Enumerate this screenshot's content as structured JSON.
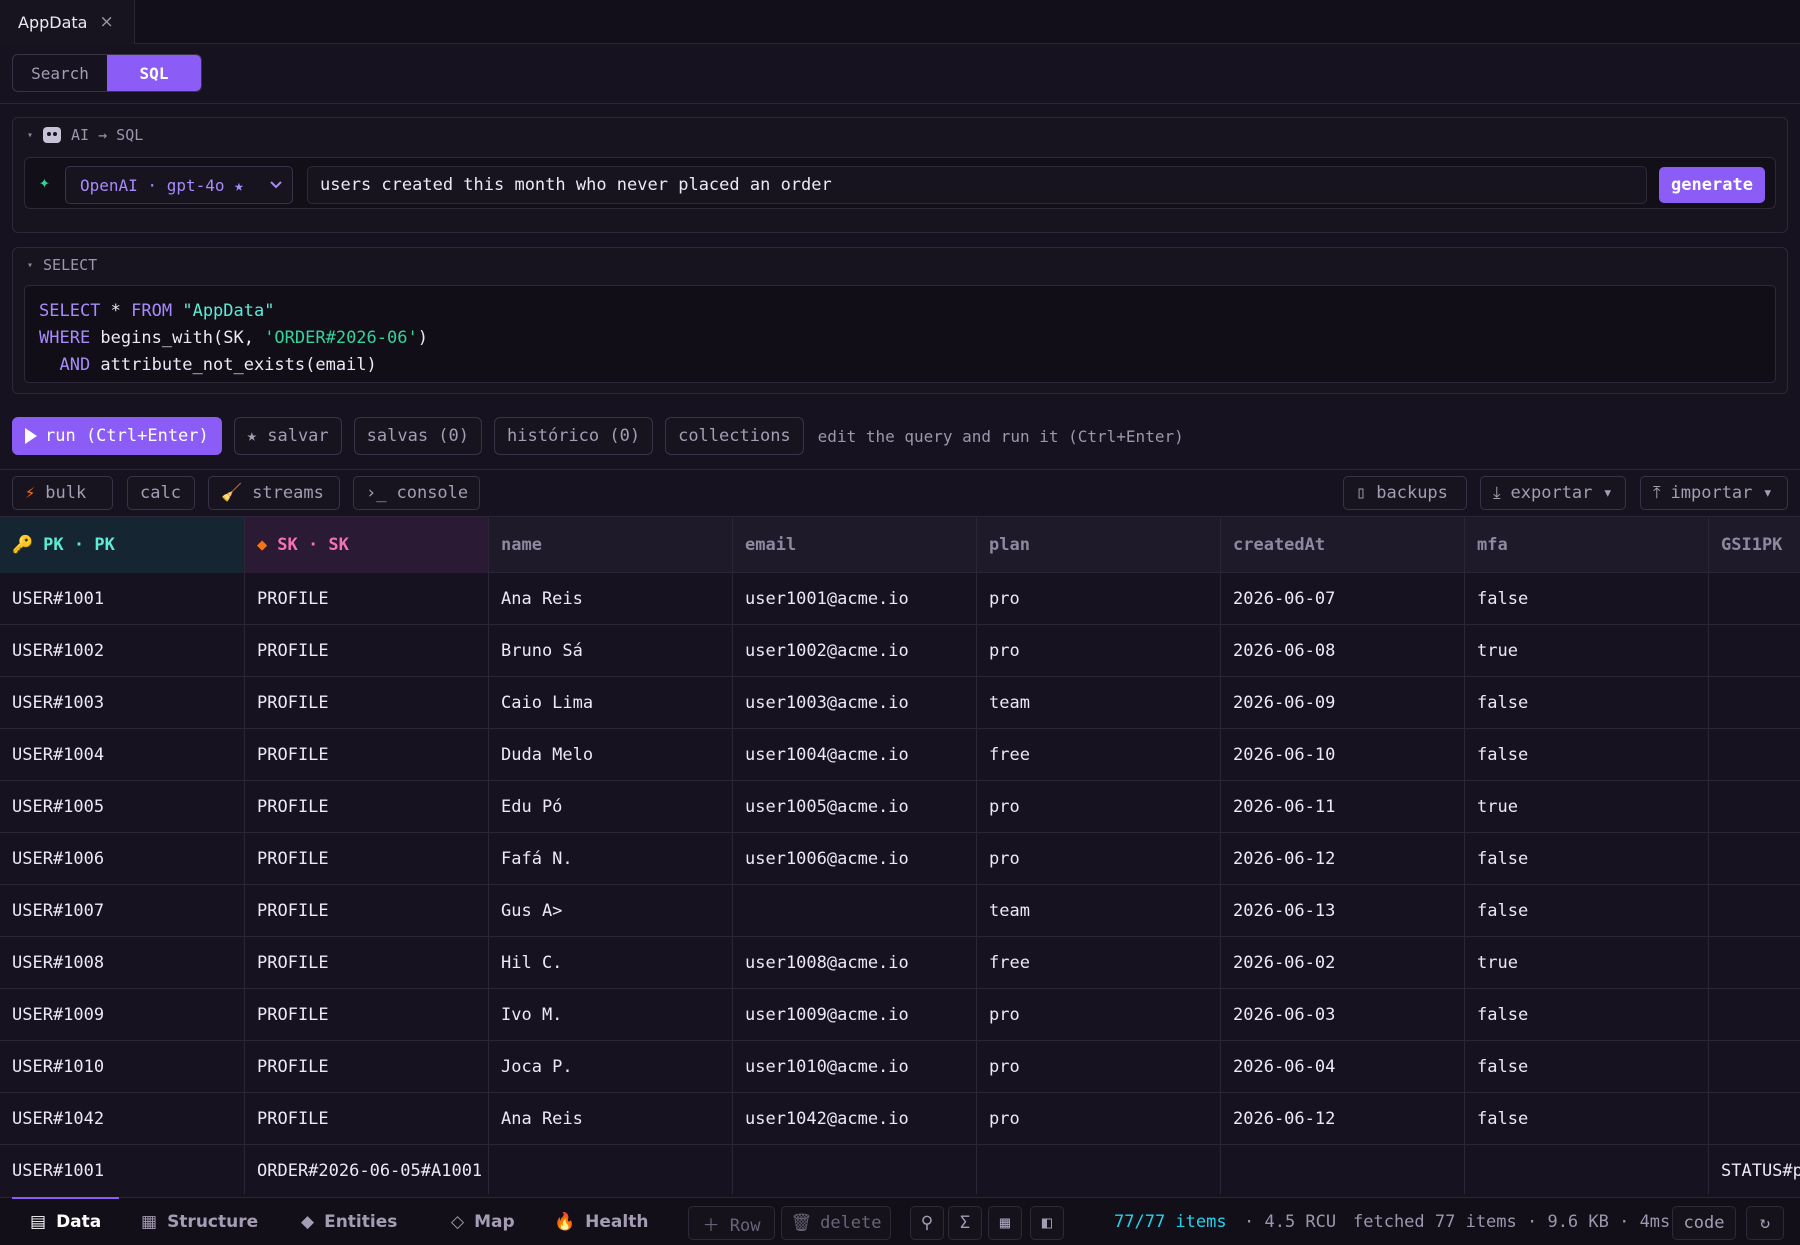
{
  "tab": {
    "title": "AppData",
    "close": "×"
  },
  "modes": {
    "search": "Search",
    "sql": "SQL"
  },
  "ai_panel": {
    "title": "AI → SQL",
    "model": "OpenAI · gpt-4o ★",
    "prompt": "users created this month who never placed an order",
    "generate": "generate"
  },
  "sql_panel": {
    "title": "SELECT",
    "lines": [
      {
        "kw1": "SELECT",
        "p1": " * ",
        "kw2": "FROM",
        "p2": " ",
        "s": "\"AppData\""
      },
      {
        "kw1": "WHERE",
        "p1": " begins_with(SK, ",
        "s": "'ORDER#2026-06'",
        "p2": ")"
      },
      {
        "kw1": "  AND",
        "p1": " attribute_not_exists(email)"
      }
    ]
  },
  "run_bar": {
    "run": "run (Ctrl+Enter)",
    "save": "★ salvar",
    "saved": "salvas (0)",
    "history": "histórico (0)",
    "collections": "collections",
    "hint": "edit the query and run it (Ctrl+Enter)"
  },
  "tools": {
    "bulk": "bulk",
    "calc": "calc",
    "streams": "streams",
    "console": "console",
    "backups": "backups",
    "export": "exportar ▾",
    "import": "importar ▾"
  },
  "table": {
    "columns": [
      "PK · PK",
      "SK · SK",
      "name",
      "email",
      "plan",
      "createdAt",
      "mfa",
      "GSI1PK"
    ],
    "rows": [
      [
        "USER#1001",
        "PROFILE",
        "Ana Reis",
        "user1001@acme.io",
        "pro",
        "2026-06-07",
        "false",
        ""
      ],
      [
        "USER#1002",
        "PROFILE",
        "Bruno Sá",
        "user1002@acme.io",
        "pro",
        "2026-06-08",
        "true",
        ""
      ],
      [
        "USER#1003",
        "PROFILE",
        "Caio Lima",
        "user1003@acme.io",
        "team",
        "2026-06-09",
        "false",
        ""
      ],
      [
        "USER#1004",
        "PROFILE",
        "Duda Melo",
        "user1004@acme.io",
        "free",
        "2026-06-10",
        "false",
        ""
      ],
      [
        "USER#1005",
        "PROFILE",
        "Edu Pó",
        "user1005@acme.io",
        "pro",
        "2026-06-11",
        "true",
        ""
      ],
      [
        "USER#1006",
        "PROFILE",
        "Fafá N.",
        "user1006@acme.io",
        "pro",
        "2026-06-12",
        "false",
        ""
      ],
      [
        "USER#1007",
        "PROFILE",
        "Gus A>",
        "",
        "team",
        "2026-06-13",
        "false",
        ""
      ],
      [
        "USER#1008",
        "PROFILE",
        "Hil C.",
        "user1008@acme.io",
        "free",
        "2026-06-02",
        "true",
        ""
      ],
      [
        "USER#1009",
        "PROFILE",
        "Ivo M.",
        "user1009@acme.io",
        "pro",
        "2026-06-03",
        "false",
        ""
      ],
      [
        "USER#1010",
        "PROFILE",
        "Joca P.",
        "user1010@acme.io",
        "pro",
        "2026-06-04",
        "false",
        ""
      ],
      [
        "USER#1042",
        "PROFILE",
        "Ana Reis",
        "user1042@acme.io",
        "pro",
        "2026-06-12",
        "false",
        ""
      ],
      [
        "USER#1001",
        "ORDER#2026-06-05#A1001",
        "",
        "",
        "",
        "",
        "",
        "STATUS#p"
      ]
    ]
  },
  "status_bar": {
    "tabs": [
      "Data",
      "Structure",
      "Entities",
      "Map",
      "Health"
    ],
    "add_row": "＋ Row",
    "delete": "delete",
    "items": "77/77 items",
    "rcu": "· 4.5 RCU",
    "fetched": "fetched 77 items · 9.6 KB · 4ms",
    "code": "code"
  },
  "colors": {
    "accent": "#8b5cf6",
    "pk": "#5eead4",
    "sk": "#f472b6",
    "keyword": "#a78bfa",
    "string": "#34d399"
  }
}
